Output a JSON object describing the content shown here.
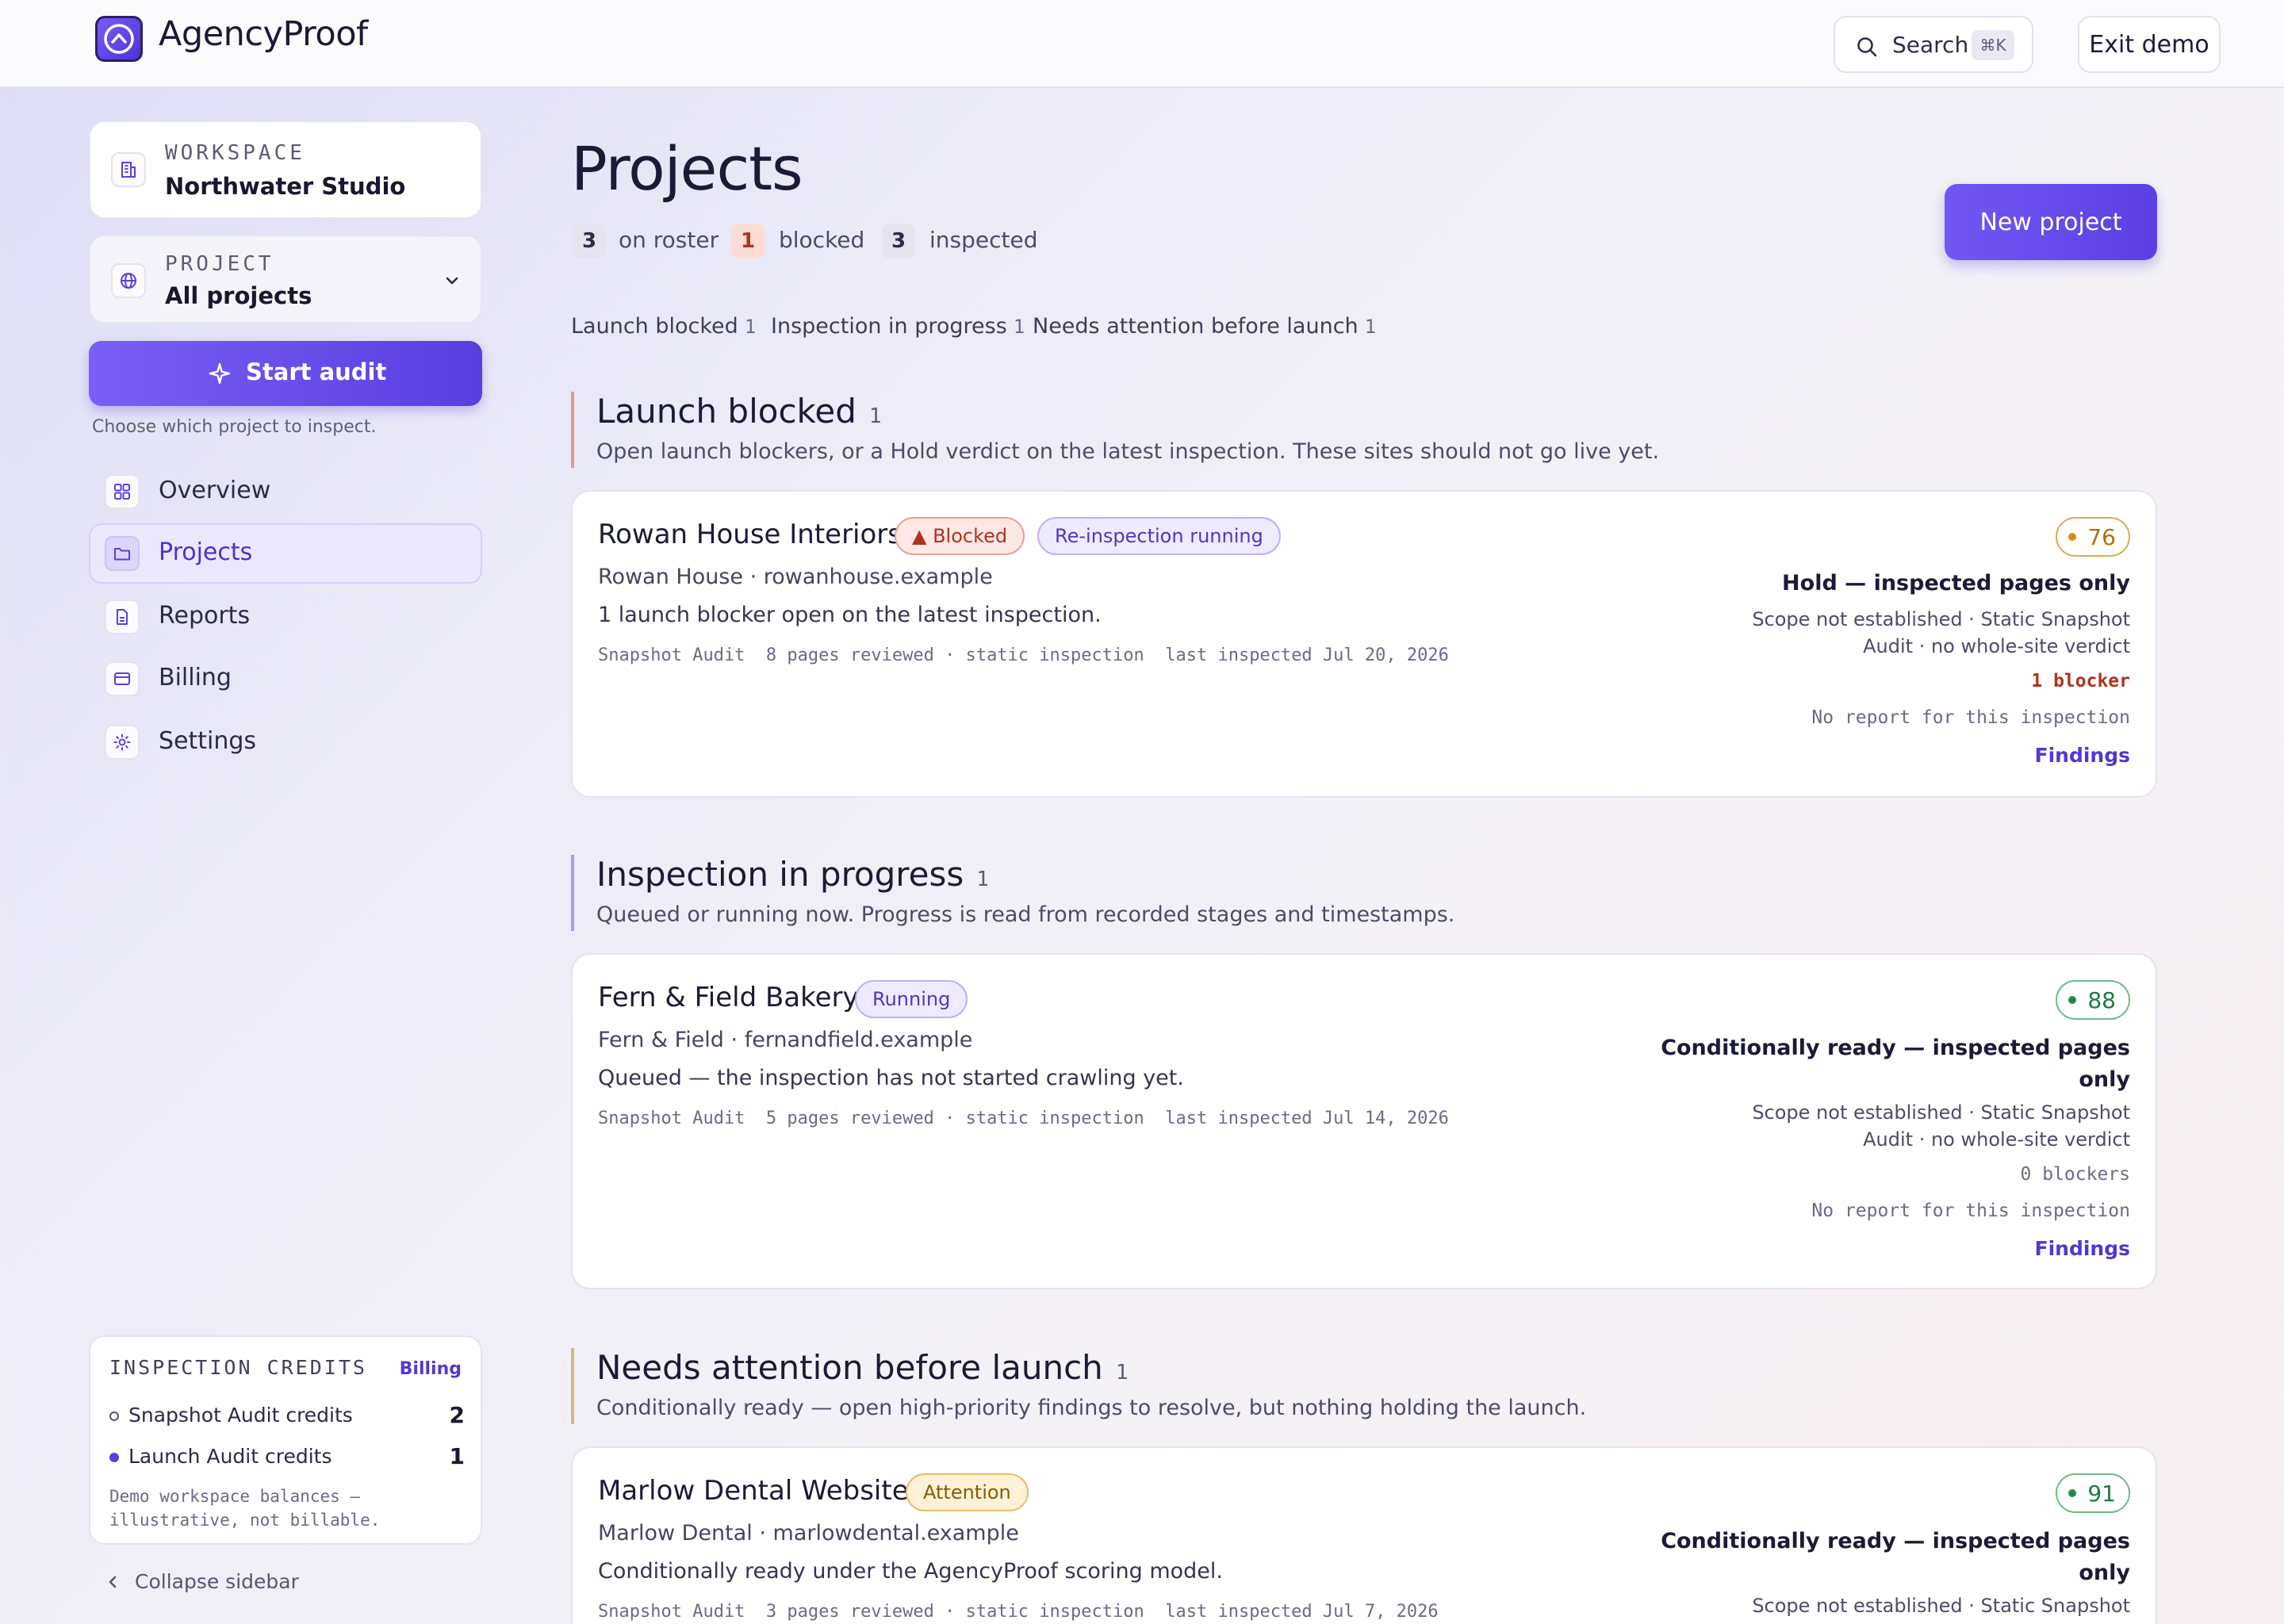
{
  "brand": {
    "name": "AgencyProof"
  },
  "topbar": {
    "search_label": "Search",
    "search_shortcut": "⌘K",
    "exit_label": "Exit demo"
  },
  "sidebar": {
    "workspace": {
      "label": "WORKSPACE",
      "value": "Northwater Studio"
    },
    "project": {
      "label": "PROJECT",
      "value": "All projects"
    },
    "start_audit_label": "Start audit",
    "start_audit_hint": "Choose which project to inspect.",
    "nav": [
      {
        "label": "Overview",
        "icon": "grid-icon"
      },
      {
        "label": "Projects",
        "icon": "folder-icon",
        "active": true
      },
      {
        "label": "Reports",
        "icon": "document-icon"
      },
      {
        "label": "Billing",
        "icon": "card-icon"
      },
      {
        "label": "Settings",
        "icon": "gear-icon"
      }
    ],
    "credits": {
      "title": "INSPECTION CREDITS",
      "billing_link": "Billing",
      "items": [
        {
          "label": "Snapshot Audit credits",
          "value": "2"
        },
        {
          "label": "Launch Audit credits",
          "value": "1"
        }
      ],
      "note_line1": "Demo workspace balances —",
      "note_line2": "illustrative, not billable."
    },
    "collapse_label": "Collapse sidebar"
  },
  "main": {
    "title": "Projects",
    "stats": [
      {
        "value": "3",
        "label": "on roster"
      },
      {
        "value": "1",
        "label": "blocked"
      },
      {
        "value": "3",
        "label": "inspected"
      }
    ],
    "new_project_label": "New project",
    "filters": [
      {
        "label": "Launch blocked",
        "count": "1"
      },
      {
        "label": "Inspection in progress",
        "count": "1"
      },
      {
        "label": "Needs attention before launch",
        "count": "1"
      }
    ],
    "sections": [
      {
        "title": "Launch blocked",
        "count": "1",
        "description": "Open launch blockers, or a Hold verdict on the latest inspection. These sites should not go live yet.",
        "accent": "#d99b93",
        "project": {
          "name": "Rowan House Interiors",
          "pills": [
            "▲ Blocked",
            "Re-inspection running"
          ],
          "client": "Rowan House · rowanhouse.example",
          "summary": "1 launch blocker open on the latest inspection.",
          "meta": "Snapshot Audit  8 pages reviewed · static inspection  last inspected Jul 20, 2026",
          "score": "76",
          "verdict_line1": "Hold — inspected pages only",
          "verdict_line2": "",
          "scope_line1": "Scope not established · Static Snapshot",
          "scope_line2": "Audit · no whole-site verdict",
          "blockers": "1 blocker",
          "report": "No report for this inspection",
          "findings": "Findings"
        }
      },
      {
        "title": "Inspection in progress",
        "count": "1",
        "description": "Queued or running now. Progress is read from recorded stages and timestamps.",
        "accent": "#a99cf0",
        "project": {
          "name": "Fern & Field Bakery",
          "pills": [
            "Running"
          ],
          "client": "Fern & Field · fernandfield.example",
          "summary": "Queued — the inspection has not started crawling yet.",
          "meta": "Snapshot Audit  5 pages reviewed · static inspection  last inspected Jul 14, 2026",
          "score": "88",
          "verdict_line1": "Conditionally ready — inspected pages",
          "verdict_line2": "only",
          "scope_line1": "Scope not established · Static Snapshot",
          "scope_line2": "Audit · no whole-site verdict",
          "blockers": "0 blockers",
          "report": "No report for this inspection",
          "findings": "Findings"
        }
      },
      {
        "title": "Needs attention before launch",
        "count": "1",
        "description": "Conditionally ready — open high-priority findings to resolve, but nothing holding the launch.",
        "accent": "#d8b77a",
        "project": {
          "name": "Marlow Dental Website",
          "pills": [
            "Attention"
          ],
          "client": "Marlow Dental · marlowdental.example",
          "summary": "Conditionally ready under the AgencyProof scoring model.",
          "meta": "Snapshot Audit  3 pages reviewed · static inspection  last inspected Jul 7, 2026",
          "score": "91",
          "verdict_line1": "Conditionally ready — inspected pages",
          "verdict_line2": "only",
          "scope_line1": "Scope not established · Static Snapshot"
        }
      }
    ]
  },
  "colors": {
    "accent": "#5b3fe2",
    "blocked_red": "#b0321f",
    "score_amber": "#c27a0e",
    "score_green": "#1f8a4c"
  }
}
